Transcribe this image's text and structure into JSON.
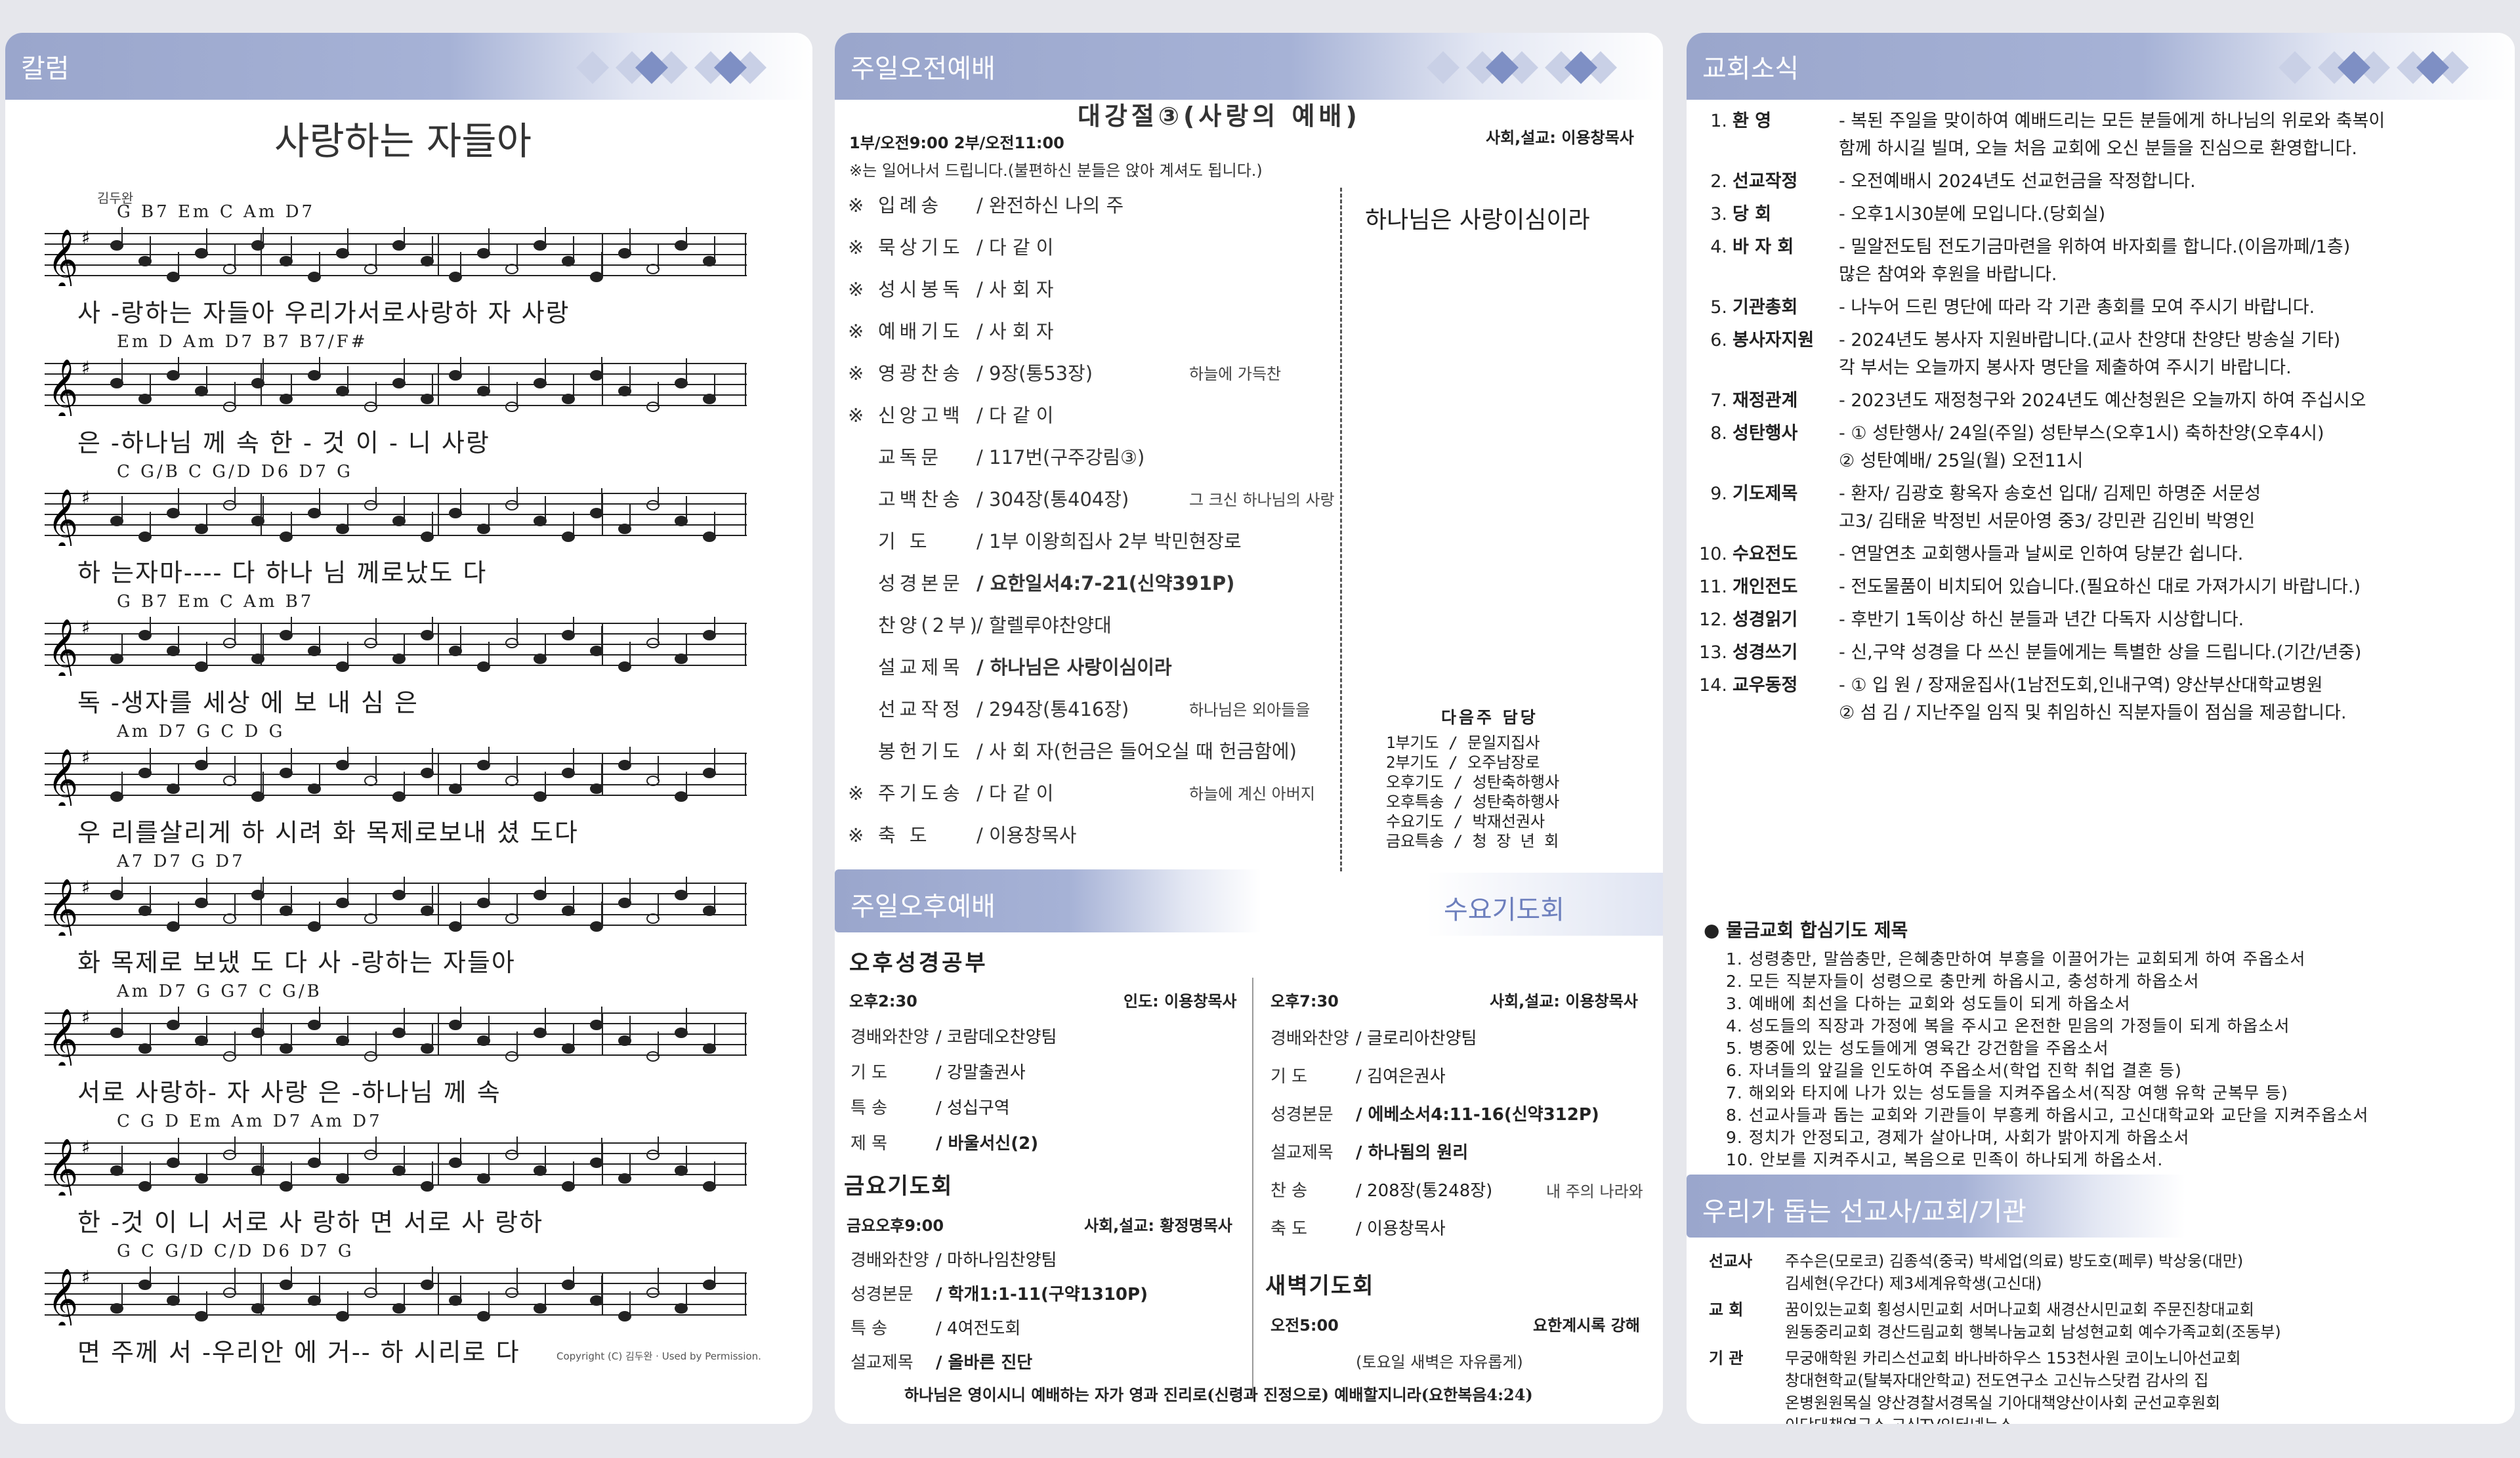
{
  "column": {
    "header": "칼럼",
    "song_title": "사랑하는 자들아",
    "author": "김두완",
    "copyright": "Copyright (C) 김두완 · Used by Permission.",
    "rows": [
      {
        "chords": "G        B7  Em   C      Am         D7",
        "lyric": "사 -랑하는 자들아  우리가서로사랑하 자  사랑"
      },
      {
        "chords": "Em        D      Am     D7     B7   B7/F#",
        "lyric": "은  -하나님   께    속   한  - 것 이 -   니   사랑"
      },
      {
        "chords": "C          G/B  C      G/D     D6 D7   G",
        "lyric": "하 는자마----  다  하나  님 께로났도  다"
      },
      {
        "chords": "G          B7     Em      C   Am      B7",
        "lyric": "독  -생자를 세상 에      보  내  심   은"
      },
      {
        "chords": "Am         D7    G  C           D      G",
        "lyric": "우 리를살리게  하 시려  화 목제로보내 셨 도다"
      },
      {
        "chords": "A7            D7       G          D7",
        "lyric": "화 목제로 보냈 도  다      사 -랑하는  자들아"
      },
      {
        "chords": "Am   D7     G  G7   C          G/B",
        "lyric": "서로 사랑하-  자  사랑   은 -하나님   께     속"
      },
      {
        "chords": "C G   D    Em   Am  D7          Am     D7",
        "lyric": "한 -것 이 니   서로 사 랑하  면   서로  사 랑하"
      },
      {
        "chords": "G          C         G/D C/D D6 D7   G",
        "lyric": "면  주께  서  -우리안 에 거-- 하 시리로  다"
      }
    ]
  },
  "morning": {
    "header": "주일오전예배",
    "theme": "대강절③(사랑의 예배)",
    "times": "1부/오전9:00   2부/오전11:00",
    "officiant": "사회,설교: 이용창목사",
    "note": "※는 일어나서 드립니다.(불편하신 분들은 앉아 계셔도 됩니다.)",
    "sermon_banner": "하나님은 사랑이심이라",
    "items": [
      {
        "star": "※",
        "label": "입례송",
        "value": "/ 완전하신 나의 주",
        "side": ""
      },
      {
        "star": "※",
        "label": "묵상기도",
        "value": "/ 다 같 이",
        "side": ""
      },
      {
        "star": "※",
        "label": "성시봉독",
        "value": "/ 사 회 자",
        "side": ""
      },
      {
        "star": "※",
        "label": "예배기도",
        "value": "/ 사 회 자",
        "side": ""
      },
      {
        "star": "※",
        "label": "영광찬송",
        "value": "/ 9장(통53장)",
        "side": "하늘에 가득찬"
      },
      {
        "star": "※",
        "label": "신앙고백",
        "value": "/ 다 같 이",
        "side": ""
      },
      {
        "star": "",
        "label": "교독문",
        "value": "/ 117번(구주강림③)",
        "side": ""
      },
      {
        "star": "",
        "label": "고백찬송",
        "value": "/ 304장(통404장)",
        "side": "그 크신 하나님의 사랑"
      },
      {
        "star": "",
        "label": "기   도",
        "value": "/ 1부 이왕희집사    2부 박민현장로",
        "side": ""
      },
      {
        "star": "",
        "label": "성경본문",
        "value": "/ 요한일서4:7-21(신약391P)",
        "side": ""
      },
      {
        "star": "",
        "label": "찬양(2부)",
        "value": "/ 할렐루야찬양대",
        "side": ""
      },
      {
        "star": "",
        "label": "설교제목",
        "value": "/ 하나님은 사랑이심이라",
        "side": ""
      },
      {
        "star": "",
        "label": "선교작정",
        "value": "/ 294장(통416장)",
        "side": "하나님은 외아들을"
      },
      {
        "star": "",
        "label": "봉헌기도",
        "value": "/ 사 회 자(헌금은 들어오실 때 헌금함에)",
        "side": ""
      },
      {
        "star": "※",
        "label": "주기도송",
        "value": "/ 다 같 이",
        "side": "하늘에 계신 아버지"
      },
      {
        "star": "※",
        "label": "축   도",
        "value": "/ 이용창목사",
        "side": ""
      }
    ],
    "next_title": "다음주 담당",
    "next": [
      "1부기도 /  문일지집사",
      "2부기도 /  오주남장로",
      "오후기도 /  성탄축하행사",
      "오후특송 /  성탄축하행사",
      "수요기도 /  박재선권사",
      "금요특송 /  청 장 년 회"
    ]
  },
  "afternoon": {
    "header": "주일오후예배",
    "study_title": "오후성경공부",
    "time": "오후2:30",
    "leader": "인도: 이용창목사",
    "items": [
      {
        "label": "경배와찬양",
        "value": "/ 코람데오찬양팀"
      },
      {
        "label": "기    도",
        "value": "/ 강말출권사"
      },
      {
        "label": "특    송",
        "value": "/ 성십구역"
      },
      {
        "label": "제    목",
        "value": "/ 바울서신(2)"
      }
    ]
  },
  "friday": {
    "title": "금요기도회",
    "time": "금요오후9:00",
    "officiant": "사회,설교: 황정명목사",
    "items": [
      {
        "label": "경배와찬양",
        "value": "/ 마하나임찬양팀"
      },
      {
        "label": "성경본문",
        "value": "/ 학개1:1-11(구약1310P)"
      },
      {
        "label": "특    송",
        "value": "/ 4여전도회"
      },
      {
        "label": "설교제목",
        "value": "/ 올바른 진단"
      }
    ]
  },
  "wednesday": {
    "header": "수요기도회",
    "time": "오후7:30",
    "officiant": "사회,설교: 이용창목사",
    "items": [
      {
        "label": "경배와찬양",
        "value": "/ 글로리아찬양팀",
        "side": ""
      },
      {
        "label": "기    도",
        "value": "/ 김여은권사",
        "side": ""
      },
      {
        "label": "성경본문",
        "value": "/ 에베소서4:11-16(신약312P)",
        "side": ""
      },
      {
        "label": "설교제목",
        "value": "/ 하나됨의 원리",
        "side": ""
      },
      {
        "label": "찬    송",
        "value": "/ 208장(통248장)",
        "side": "내 주의 나라와"
      },
      {
        "label": "축    도",
        "value": "/ 이용창목사",
        "side": ""
      }
    ]
  },
  "dawn": {
    "title": "새벽기도회",
    "time": "오전5:00",
    "text": "요한계시록 강해",
    "note": "(토요일 새벽은 자유롭게)"
  },
  "verse": "하나님은 영이시니 예배하는 자가 영과 진리로(신령과 진정으로) 예배할지니라(요한복음4:24)",
  "news": {
    "header": "교회소식",
    "items": [
      {
        "n": "1.",
        "k": "환    영",
        "lines": [
          "- 복된 주일을 맞이하여 예배드리는 모든 분들에게 하나님의 위로와 축복이",
          "  함께 하시길 빌며, 오늘 처음 교회에 오신 분들을 진심으로 환영합니다."
        ]
      },
      {
        "n": "2.",
        "k": "선교작정",
        "lines": [
          "- 오전예배시 2024년도 선교헌금을 작정합니다."
        ]
      },
      {
        "n": "3.",
        "k": "당    회",
        "lines": [
          "- 오후1시30분에 모입니다.(당회실)"
        ]
      },
      {
        "n": "4.",
        "k": "바 자 회",
        "lines": [
          "- 밀알전도팀 전도기금마련을 위하여 바자회를 합니다.(이음까페/1층)",
          "  많은 참여와 후원을 바랍니다."
        ]
      },
      {
        "n": "5.",
        "k": "기관총회",
        "lines": [
          "- 나누어 드린 명단에 따라 각 기관 총회를 모여 주시기 바랍니다."
        ]
      },
      {
        "n": "6.",
        "k": "봉사자지원",
        "lines": [
          "- 2024년도 봉사자 지원바랍니다.(교사 찬양대 찬양단 방송실 기타)",
          "  각 부서는 오늘까지 봉사자 명단을 제출하여 주시기 바랍니다."
        ]
      },
      {
        "n": "7.",
        "k": "재정관계",
        "lines": [
          "- 2023년도 재정청구와 2024년도 예산청원은 오늘까지 하여 주십시오"
        ]
      },
      {
        "n": "8.",
        "k": "성탄행사",
        "lines": [
          "- ① 성탄행사/ 24일(주일)   성탄부스(오후1시)   축하찬양(오후4시)",
          "  ② 성탄예배/ 25일(월)       오전11시"
        ]
      },
      {
        "n": "9.",
        "k": "기도제목",
        "lines": [
          "- 환자/ 김광호 황옥자 송호선          입대/ 김제민 하명준 서문성",
          "  고3/ 김태윤 박정빈 서문아영          중3/ 강민관 김인비 박영인"
        ]
      },
      {
        "n": "10.",
        "k": "수요전도",
        "lines": [
          "- 연말연초 교회행사들과 날씨로 인하여 당분간 쉽니다."
        ]
      },
      {
        "n": "11.",
        "k": "개인전도",
        "lines": [
          "- 전도물품이 비치되어 있습니다.(필요하신 대로 가져가시기 바랍니다.)"
        ]
      },
      {
        "n": "12.",
        "k": "성경읽기",
        "lines": [
          "- 후반기 1독이상 하신 분들과 년간 다독자 시상합니다."
        ]
      },
      {
        "n": "13.",
        "k": "성경쓰기",
        "lines": [
          "- 신,구약 성경을 다 쓰신 분들에게는 특별한 상을 드립니다.(기간/년중)"
        ]
      },
      {
        "n": "14.",
        "k": "교우동정",
        "lines": [
          "- ① 입 원 / 장재윤집사(1남전도회,인내구역) 양산부산대학교병원",
          "  ② 섬 김 / 지난주일 임직 및 취임하신 직분자들이 점심을 제공합니다."
        ]
      }
    ]
  },
  "prayer": {
    "title": "● 물금교회 합심기도 제목",
    "items": [
      "1. 성령충만, 말씀충만, 은혜충만하여 부흥을 이끌어가는 교회되게 하여 주옵소서",
      "2. 모든 직분자들이 성령으로 충만케 하옵시고, 충성하게 하옵소서",
      "3. 예배에 최선을 다하는 교회와 성도들이 되게 하옵소서",
      "4. 성도들의 직장과 가정에 복을 주시고 온전한 믿음의 가정들이 되게 하옵소서",
      "5. 병중에 있는 성도들에게 영육간 강건함을 주옵소서",
      "6. 자녀들의 앞길을 인도하여 주옵소서(학업 진학 취업 결혼 등)",
      "7. 해외와 타지에 나가 있는 성도들을 지켜주옵소서(직장 여행 유학 군복무 등)",
      "8. 선교사들과 돕는 교회와 기관들이 부흥케 하옵시고, 고신대학교와 교단을 지켜주옵소서",
      "9. 정치가 안정되고, 경제가 살아나며, 사회가 밝아지게 하옵소서",
      "10. 안보를 지켜주시고, 복음으로 민족이 하나되게 하옵소서."
    ]
  },
  "support": {
    "header": "우리가 돕는 선교사/교회/기관",
    "missionary_label": "선교사",
    "missionary": [
      "주수은(모로코) 김종석(중국) 박세업(의료) 방도호(페루) 박상웅(대만)",
      "김세현(우간다) 제3세계유학생(고신대)"
    ],
    "church_label": "교  회",
    "church": [
      "꿈이있는교회 횡성시민교회 서머나교회 새경산시민교회 주문진창대교회",
      "원동중리교회 경산드림교회 행복나눔교회 남성현교회 예수가족교회(조동부)"
    ],
    "org_label": "기  관",
    "org": [
      "무궁애학원 카리스선교회 바나바하우스 153천사원 코이노니아선교회",
      "창대현학교(탈북자대안학교)  전도연구소 고신뉴스닷컴 감사의 집",
      "온병원원목실 양산경찰서경목실 기아대책양산이사회 군선교후원회",
      "이단대책연구소 고신TV인터넷뉴스"
    ]
  }
}
